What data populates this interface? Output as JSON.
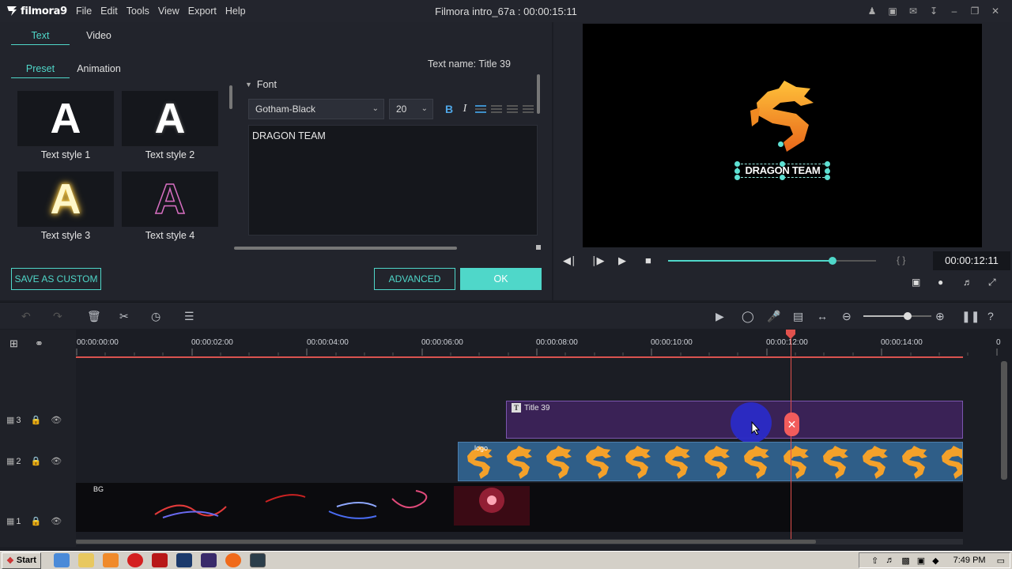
{
  "app": {
    "brand": "filmora9",
    "window_title": "Filmora intro_67a : 00:00:15:11",
    "menu": [
      "File",
      "Edit",
      "Tools",
      "View",
      "Export",
      "Help"
    ],
    "window_icons": [
      "account-icon",
      "save-icon",
      "mail-icon",
      "download-icon",
      "minimize-icon",
      "maximize-icon",
      "close-icon"
    ]
  },
  "editor": {
    "tabs": [
      "Text",
      "Video"
    ],
    "subtabs": [
      "Preset",
      "Animation"
    ],
    "presets": [
      "Text style 1",
      "Text style 2",
      "Text style 3",
      "Text style 4"
    ],
    "preset_glyph": "A",
    "text_name": "Text name: Title 39",
    "font_section": "Font",
    "font_family": "Gotham-Black",
    "font_size": "20",
    "bold": "B",
    "italic": "I",
    "text_content": "DRAGON TEAM",
    "save_custom": "SAVE AS CUSTOM",
    "advanced": "ADVANCED",
    "ok": "OK"
  },
  "preview": {
    "caption": "DRAGON TEAM",
    "timecode": "00:00:12:11",
    "progress": 0.79,
    "braces": "{   }"
  },
  "timeline": {
    "ruler": [
      "00:00:00:00",
      "00:00:02:00",
      "00:00:04:00",
      "00:00:06:00",
      "00:00:08:00",
      "00:00:10:00",
      "00:00:12:00",
      "00:00:14:00",
      "0"
    ],
    "tracks": [
      {
        "num": "3",
        "clip": "Title 39"
      },
      {
        "num": "2",
        "clip": "logo"
      },
      {
        "num": "1",
        "clip": "BG"
      }
    ],
    "zoom": 0.65
  },
  "taskbar": {
    "start": "Start",
    "clock": "7:49 PM"
  },
  "colors": {
    "accent": "#4fd7c9",
    "title_clip": "#3a2256",
    "logo_clip": "#2f5e88",
    "playhead": "#e0514d"
  }
}
